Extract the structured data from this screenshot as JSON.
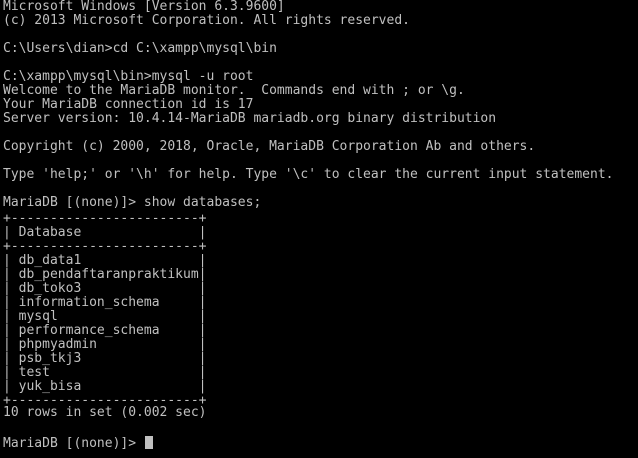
{
  "terminal": {
    "lines": [
      "Microsoft Windows [Version 6.3.9600]",
      "(c) 2013 Microsoft Corporation. All rights reserved.",
      "",
      "C:\\Users\\dian>cd C:\\xampp\\mysql\\bin",
      "",
      "C:\\xampp\\mysql\\bin>mysql -u root",
      "Welcome to the MariaDB monitor.  Commands end with ; or \\g.",
      "Your MariaDB connection id is 17",
      "Server version: 10.4.14-MariaDB mariadb.org binary distribution",
      "",
      "Copyright (c) 2000, 2018, Oracle, MariaDB Corporation Ab and others.",
      "",
      "Type 'help;' or '\\h' for help. Type '\\c' to clear the current input statement.",
      "",
      "MariaDB [(none)]> show databases;",
      "+------------------------+",
      "| Database               |",
      "+------------------------+",
      "| db_data1               |",
      "| db_pendaftaranpraktikum|",
      "| db_toko3               |",
      "| information_schema     |",
      "| mysql                  |",
      "| performance_schema     |",
      "| phpmyadmin             |",
      "| psb_tkj3               |",
      "| test                   |",
      "| yuk_bisa               |",
      "+------------------------+",
      "10 rows in set (0.002 sec)",
      "",
      "MariaDB [(none)]> "
    ],
    "colors": {
      "background": "#000000",
      "foreground": "#c0c0c0"
    }
  }
}
